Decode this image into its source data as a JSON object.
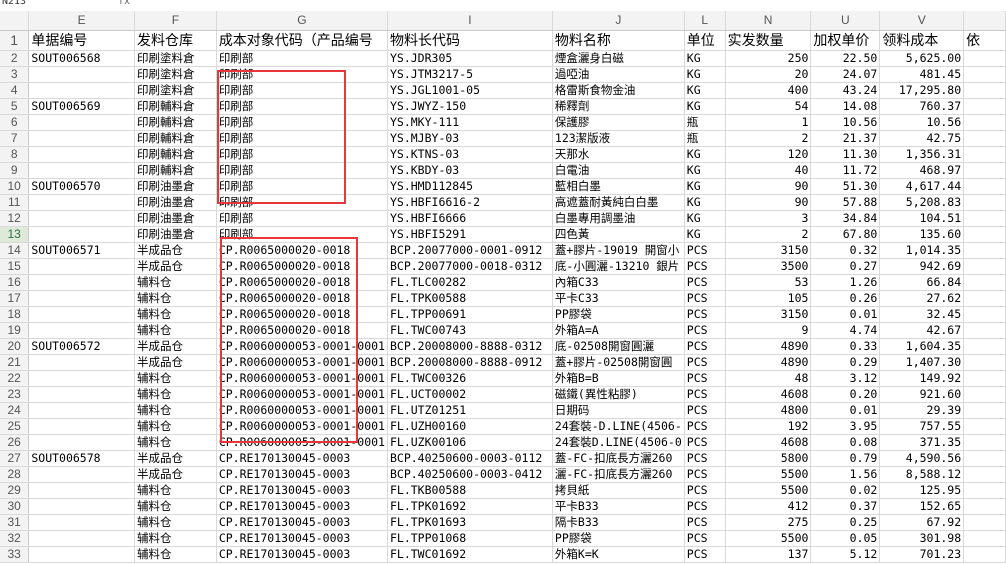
{
  "formula_bar": {
    "name_box": "N213",
    "fx_label": "fx"
  },
  "columns": [
    "E",
    "F",
    "G",
    "I",
    "J",
    "L",
    "N",
    "U",
    "V",
    ""
  ],
  "header": {
    "row_number": "1",
    "cells": [
      "单据编号",
      "发料仓库",
      "成本对象代码（产品编号",
      "物料长代码",
      "物料名称",
      "单位",
      "实发数量",
      "加权单价",
      "领料成本",
      "依"
    ]
  },
  "rows": [
    {
      "n": "2",
      "c": [
        "SOUT006568",
        "印刷塗料倉",
        "印刷部",
        "YS.JDR305",
        "煙盒灑身白磁",
        "KG",
        "250",
        "22.50",
        "5,625.00"
      ]
    },
    {
      "n": "3",
      "c": [
        "",
        "印刷塗料倉",
        "印刷部",
        "YS.JTM3217-5",
        "過啞油",
        "KG",
        "20",
        "24.07",
        "481.45"
      ]
    },
    {
      "n": "4",
      "c": [
        "",
        "印刷塗料倉",
        "印刷部",
        "YS.JGL1001-05",
        "格雷斯食物金油",
        "KG",
        "400",
        "43.24",
        "17,295.80"
      ]
    },
    {
      "n": "5",
      "c": [
        "SOUT006569",
        "印刷輔料倉",
        "印刷部",
        "YS.JWYZ-150",
        "稀釋劑",
        "KG",
        "54",
        "14.08",
        "760.37"
      ]
    },
    {
      "n": "6",
      "c": [
        "",
        "印刷輔料倉",
        "印刷部",
        "YS.MKY-111",
        "保護膠",
        "瓶",
        "1",
        "10.56",
        "10.56"
      ]
    },
    {
      "n": "7",
      "c": [
        "",
        "印刷輔料倉",
        "印刷部",
        "YS.MJBY-03",
        "123潔版液",
        "瓶",
        "2",
        "21.37",
        "42.75"
      ]
    },
    {
      "n": "8",
      "c": [
        "",
        "印刷輔料倉",
        "印刷部",
        "YS.KTNS-03",
        "天那水",
        "KG",
        "120",
        "11.30",
        "1,356.31"
      ]
    },
    {
      "n": "9",
      "c": [
        "",
        "印刷輔料倉",
        "印刷部",
        "YS.KBDY-03",
        "白電油",
        "KG",
        "40",
        "11.72",
        "468.97"
      ]
    },
    {
      "n": "10",
      "c": [
        "SOUT006570",
        "印刷油墨倉",
        "印刷部",
        "YS.HMD112845",
        "藍相白墨",
        "KG",
        "90",
        "51.30",
        "4,617.44"
      ]
    },
    {
      "n": "11",
      "c": [
        "",
        "印刷油墨倉",
        "印刷部",
        "YS.HBFI6616-2",
        "高遮蓋耐黃純白白墨",
        "KG",
        "90",
        "57.88",
        "5,208.83"
      ]
    },
    {
      "n": "12",
      "c": [
        "",
        "印刷油墨倉",
        "印刷部",
        "YS.HBFI6666",
        "白墨專用調墨油",
        "KG",
        "3",
        "34.84",
        "104.51"
      ]
    },
    {
      "n": "13",
      "c": [
        "",
        "印刷油墨倉",
        "印刷部",
        "YS.HBFI5291",
        "四色黃",
        "KG",
        "2",
        "67.80",
        "135.60"
      ]
    },
    {
      "n": "14",
      "c": [
        "SOUT006571",
        "半成品仓",
        "CP.R0065000020-0018",
        "BCP.20077000-0001-0912",
        "蓋+膠片-19019 開窗小",
        "PCS",
        "3150",
        "0.32",
        "1,014.35"
      ]
    },
    {
      "n": "15",
      "c": [
        "",
        "半成品仓",
        "CP.R0065000020-0018",
        "BCP.20077000-0018-0312",
        "底-小圓灑-13210 銀片",
        "PCS",
        "3500",
        "0.27",
        "942.69"
      ]
    },
    {
      "n": "16",
      "c": [
        "",
        "辅料仓",
        "CP.R0065000020-0018",
        "FL.TLC00282",
        "內箱C33",
        "PCS",
        "53",
        "1.26",
        "66.84"
      ]
    },
    {
      "n": "17",
      "c": [
        "",
        "辅料仓",
        "CP.R0065000020-0018",
        "FL.TPK00588",
        "平卡C33",
        "PCS",
        "105",
        "0.26",
        "27.62"
      ]
    },
    {
      "n": "18",
      "c": [
        "",
        "辅料仓",
        "CP.R0065000020-0018",
        "FL.TPP00691",
        "PP膠袋",
        "PCS",
        "3150",
        "0.01",
        "32.45"
      ]
    },
    {
      "n": "19",
      "c": [
        "",
        "辅料仓",
        "CP.R0065000020-0018",
        "FL.TWC00743",
        "外箱A=A",
        "PCS",
        "9",
        "4.74",
        "42.67"
      ]
    },
    {
      "n": "20",
      "c": [
        "SOUT006572",
        "半成品仓",
        "CP.R0060000053-0001-0001",
        "BCP.20008000-8888-0312",
        "底-02508開窗圓灑",
        "PCS",
        "4890",
        "0.33",
        "1,604.35"
      ]
    },
    {
      "n": "21",
      "c": [
        "",
        "半成品仓",
        "CP.R0060000053-0001-0001",
        "BCP.20008000-8888-0912",
        "蓋+膠片-02508開窗圓",
        "PCS",
        "4890",
        "0.29",
        "1,407.30"
      ]
    },
    {
      "n": "22",
      "c": [
        "",
        "辅料仓",
        "CP.R0060000053-0001-0001",
        "FL.TWC00326",
        "外箱B=B",
        "PCS",
        "48",
        "3.12",
        "149.92"
      ]
    },
    {
      "n": "23",
      "c": [
        "",
        "辅料仓",
        "CP.R0060000053-0001-0001",
        "FL.UCT00002",
        "磁鐵(異性粘膠)",
        "PCS",
        "4608",
        "0.20",
        "921.60"
      ]
    },
    {
      "n": "24",
      "c": [
        "",
        "辅料仓",
        "CP.R0060000053-0001-0001",
        "FL.UTZ01251",
        "日期码",
        "PCS",
        "4800",
        "0.01",
        "29.39"
      ]
    },
    {
      "n": "25",
      "c": [
        "",
        "辅料仓",
        "CP.R0060000053-0001-0001",
        "FL.UZH00160",
        "24套裝-D.LINE(4506-",
        "PCS",
        "192",
        "3.95",
        "757.55"
      ]
    },
    {
      "n": "26",
      "c": [
        "",
        "辅料仓",
        "CP.R0060000053-0001-0001",
        "FL.UZK00106",
        "24套裝D.LINE(4506-0",
        "PCS",
        "4608",
        "0.08",
        "371.35"
      ]
    },
    {
      "n": "27",
      "c": [
        "SOUT006578",
        "半成品仓",
        "CP.RE170130045-0003",
        "BCP.40250600-0003-0112",
        "蓋-FC-扣底長方灑260",
        "PCS",
        "5800",
        "0.79",
        "4,590.56"
      ]
    },
    {
      "n": "28",
      "c": [
        "",
        "半成品仓",
        "CP.RE170130045-0003",
        "BCP.40250600-0003-0412",
        "灑-FC-扣底長方灑260",
        "PCS",
        "5500",
        "1.56",
        "8,588.12"
      ]
    },
    {
      "n": "29",
      "c": [
        "",
        "辅料仓",
        "CP.RE170130045-0003",
        "FL.TKB00588",
        "拷貝紙",
        "PCS",
        "5500",
        "0.02",
        "125.95"
      ]
    },
    {
      "n": "30",
      "c": [
        "",
        "辅料仓",
        "CP.RE170130045-0003",
        "FL.TPK01692",
        "平卡B33",
        "PCS",
        "412",
        "0.37",
        "152.65"
      ]
    },
    {
      "n": "31",
      "c": [
        "",
        "辅料仓",
        "CP.RE170130045-0003",
        "FL.TPK01693",
        "隔卡B33",
        "PCS",
        "275",
        "0.25",
        "67.92"
      ]
    },
    {
      "n": "32",
      "c": [
        "",
        "辅料仓",
        "CP.RE170130045-0003",
        "FL.TPP01068",
        "PP膠袋",
        "PCS",
        "5500",
        "0.05",
        "301.98"
      ]
    },
    {
      "n": "33",
      "c": [
        "",
        "辅料仓",
        "CP.RE170130045-0003",
        "FL.TWC01692",
        "外箱K=K",
        "PCS",
        "137",
        "5.12",
        "701.23"
      ]
    }
  ],
  "active_row": "13",
  "highlight_color": "#e8373a"
}
